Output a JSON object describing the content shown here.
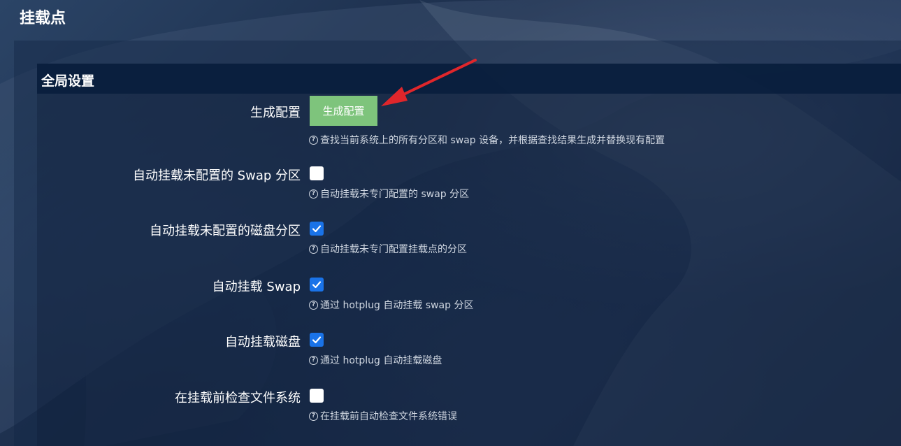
{
  "page": {
    "title": "挂载点"
  },
  "section": {
    "title": "全局设置",
    "generate": {
      "label": "生成配置",
      "button_label": "生成配置",
      "help": "查找当前系统上的所有分区和 swap 设备，并根据查找结果生成并替换现有配置"
    },
    "options": [
      {
        "label": "自动挂载未配置的 Swap 分区",
        "checked": false,
        "help": "自动挂载未专门配置的 swap 分区"
      },
      {
        "label": "自动挂载未配置的磁盘分区",
        "checked": true,
        "help": "自动挂载未专门配置挂载点的分区"
      },
      {
        "label": "自动挂载 Swap",
        "checked": true,
        "help": "通过 hotplug 自动挂载 swap 分区"
      },
      {
        "label": "自动挂载磁盘",
        "checked": true,
        "help": "通过 hotplug 自动挂载磁盘"
      },
      {
        "label": "在挂载前检查文件系统",
        "checked": false,
        "help": "在挂载前自动检查文件系统错误"
      }
    ]
  },
  "colors": {
    "button_green": "#7ec47c",
    "checkbox_blue": "#1a73e8",
    "arrow_red": "#e0262b",
    "header_bg": "#081e3c"
  },
  "icons": {
    "help": "question-circle-icon",
    "check": "checkmark-icon",
    "arrow": "red-arrow-annotation"
  }
}
